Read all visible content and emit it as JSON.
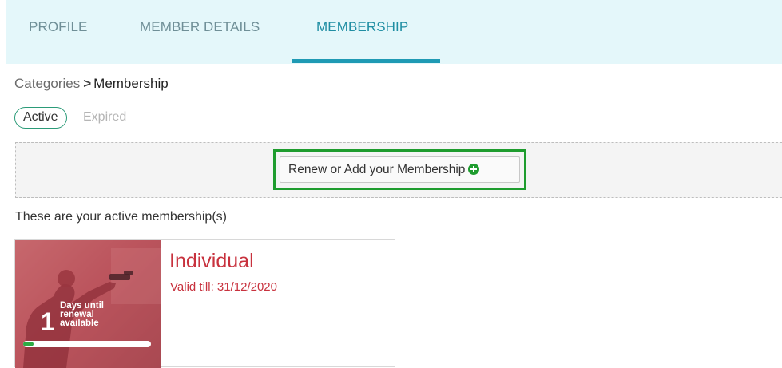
{
  "nav": {
    "tabs": [
      {
        "label": "PROFILE",
        "active": false
      },
      {
        "label": "MEMBER DETAILS",
        "active": false
      },
      {
        "label": "MEMBERSHIP",
        "active": true
      }
    ],
    "accent_color": "#1f9ab4"
  },
  "breadcrumb": {
    "parent": "Categories",
    "separator": ">",
    "current": "Membership"
  },
  "filters": {
    "active_label": "Active",
    "expired_label": "Expired",
    "selected": "Active"
  },
  "renew": {
    "button_label": "Renew or Add your Membership",
    "icon": "plus-circle-icon",
    "highlight_color": "#1e9c2e"
  },
  "memberships": {
    "heading": "These are your active membership(s)",
    "cards": [
      {
        "title": "Individual",
        "valid_till": "Valid till: 31/12/2020",
        "days_count": "1",
        "days_label": "Days until renewal available",
        "renewal_progress": 0.08,
        "title_color": "#c8323e"
      }
    ]
  }
}
